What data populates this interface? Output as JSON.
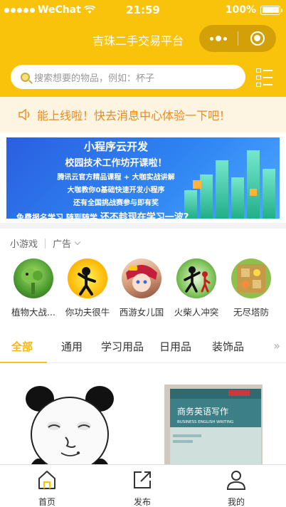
{
  "status_bar": {
    "carrier": "WeChat",
    "time": "21:59",
    "battery": "100%"
  },
  "nav": {
    "title": "吉珠二手交易平台"
  },
  "search": {
    "placeholder": "搜索想要的物品，例如：杯子"
  },
  "notice": {
    "text": "能上线啦！快去消息中心体验一下吧！"
  },
  "banner": {
    "line1": "小程序云开发",
    "line2": "校园技术工作坊开课啦！",
    "line3": "腾讯云官方精品课程 + 大咖实战讲解",
    "line4": "大咖教你0基础快速开发小程序",
    "line5": "还有全国挑战赛参与即有奖",
    "line6_small": "免费报名学习 随到随学",
    "line6_big": "还不趁现在学习一波?"
  },
  "games": {
    "title": "小游戏",
    "ad_label": "广告",
    "items": [
      {
        "name": "植物大战..."
      },
      {
        "name": "你功夫很牛"
      },
      {
        "name": "西游女儿国"
      },
      {
        "name": "火柴人冲突"
      },
      {
        "name": "无尽塔防"
      }
    ]
  },
  "categories": {
    "tabs": [
      "全部",
      "通用",
      "学习用品",
      "日用品",
      "装饰品"
    ],
    "active": "全部",
    "more_glyph": "»"
  },
  "goods": {
    "book_title": "商务英语写作",
    "book_subtitle": "BUSINESS ENGLISH WRITING"
  },
  "tabbar": {
    "items": [
      {
        "label": "首页",
        "icon": "home-icon"
      },
      {
        "label": "发布",
        "icon": "publish-icon"
      },
      {
        "label": "我的",
        "icon": "profile-icon"
      }
    ]
  },
  "colors": {
    "brand": "#f9c20b",
    "notice_text": "#ee8a1a",
    "notice_bg": "#fdf4e2"
  }
}
